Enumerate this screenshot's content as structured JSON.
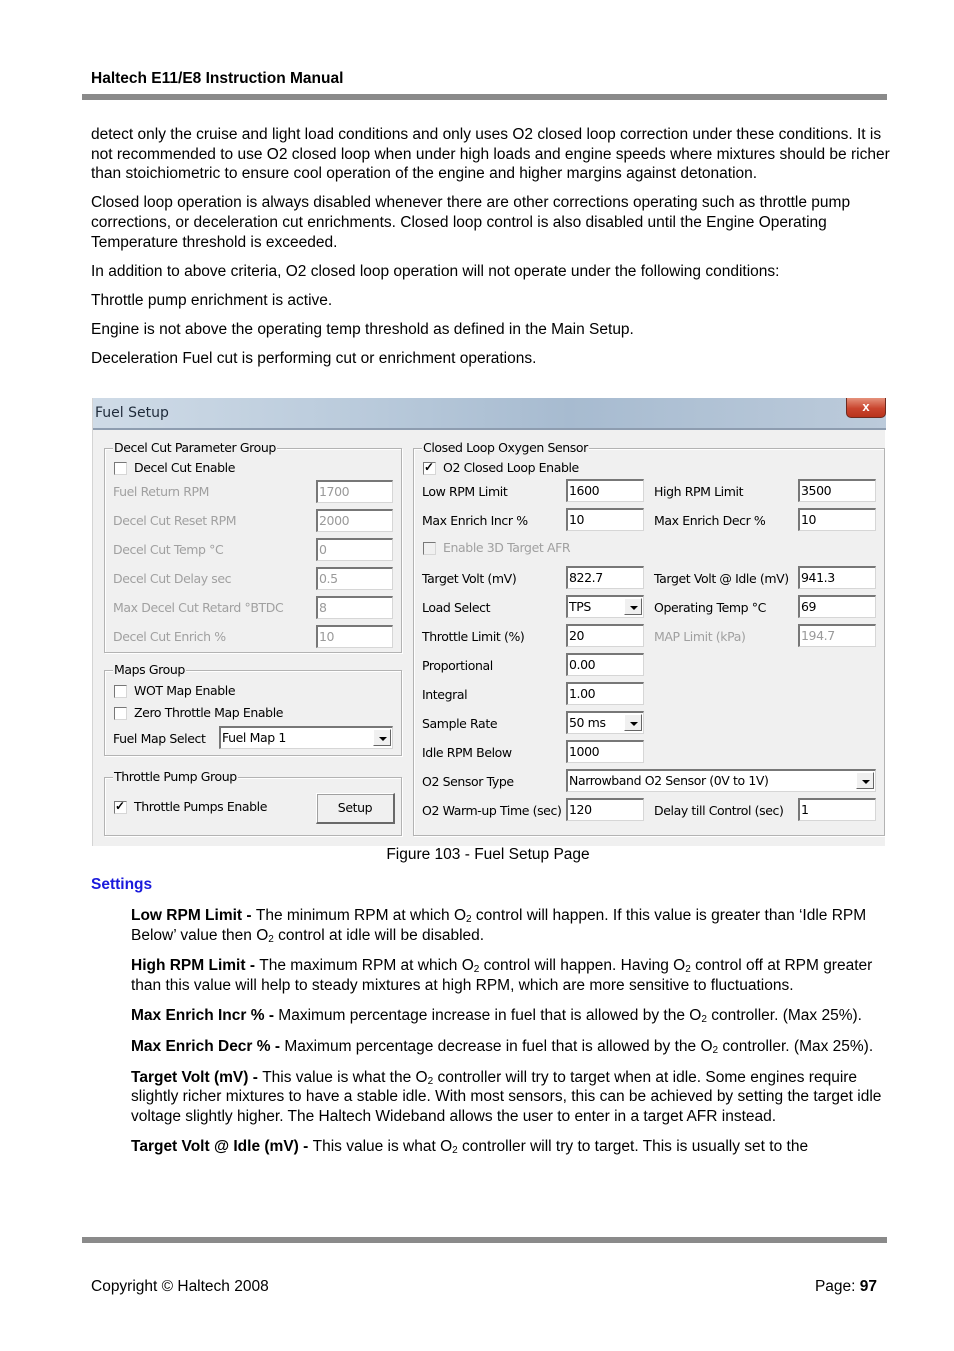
{
  "header": {
    "title": "Haltech E11/E8 Instruction Manual"
  },
  "intro_paragraphs": [
    "detect only the cruise and light load conditions and only uses O2 closed loop correction under these conditions. It is not recommended to use O2 closed loop when under high loads and engine speeds where mixtures should be richer than stoichiometric to ensure cool operation of the engine and higher margins against detonation.",
    "Closed loop operation is always disabled whenever there are other corrections operating such as throttle pump corrections, or deceleration cut enrichments. Closed loop control is also disabled until the Engine Operating Temperature threshold is exceeded.",
    "In addition to above criteria, O2 closed loop operation will not operate under the following conditions:",
    "Throttle pump enrichment is active.",
    "Engine is not above the operating temp threshold as defined in the Main Setup.",
    "Deceleration Fuel cut is performing cut or enrichment operations."
  ],
  "dialog": {
    "title": "Fuel Setup",
    "close_label": "x",
    "decel_group": {
      "title": "Decel Cut Parameter Group",
      "enable_label": "Decel Cut Enable",
      "enable_checked": false,
      "fields": [
        {
          "label": "Fuel Return RPM",
          "value": "1700"
        },
        {
          "label": "Decel Cut Reset RPM",
          "value": "2000"
        },
        {
          "label": "Decel Cut Temp °C",
          "value": "0"
        },
        {
          "label": "Decel Cut Delay sec",
          "value": "0.5"
        },
        {
          "label": "Max Decel Cut Retard °BTDC",
          "value": "8"
        },
        {
          "label": "Decel Cut Enrich %",
          "value": "10"
        }
      ]
    },
    "maps_group": {
      "title": "Maps Group",
      "wot_label": "WOT Map Enable",
      "wot_checked": false,
      "zero_throttle_label": "Zero Throttle Map Enable",
      "zero_throttle_checked": false,
      "fuel_map_label": "Fuel Map Select",
      "fuel_map_value": "Fuel Map 1"
    },
    "throttle_pump_group": {
      "title": "Throttle Pump Group",
      "enable_label": "Throttle Pumps Enable",
      "enable_checked": true,
      "setup_button": "Setup"
    },
    "o2_group": {
      "title": "Closed Loop Oxygen Sensor",
      "enable_label": "O2 Closed Loop Enable",
      "enable_checked": true,
      "low_rpm_label": "Low RPM Limit",
      "low_rpm_value": "1600",
      "high_rpm_label": "High RPM Limit",
      "high_rpm_value": "3500",
      "max_incr_label": "Max Enrich Incr %",
      "max_incr_value": "10",
      "max_decr_label": "Max Enrich Decr %",
      "max_decr_value": "10",
      "enable_3d_label": "Enable 3D Target AFR",
      "enable_3d_checked": false,
      "target_volt_label": "Target Volt (mV)",
      "target_volt_value": "822.7",
      "target_volt_idle_label": "Target Volt @ Idle (mV)",
      "target_volt_idle_value": "941.3",
      "load_select_label": "Load Select",
      "load_select_value": "TPS",
      "operating_temp_label": "Operating Temp °C",
      "operating_temp_value": "69",
      "throttle_limit_label": "Throttle Limit (%)",
      "throttle_limit_value": "20",
      "map_limit_label": "MAP Limit (kPa)",
      "map_limit_value": "194.7",
      "proportional_label": "Proportional",
      "proportional_value": "0.00",
      "integral_label": "Integral",
      "integral_value": "1.00",
      "sample_rate_label": "Sample Rate",
      "sample_rate_value": "50 ms",
      "idle_rpm_label": "Idle RPM Below",
      "idle_rpm_value": "1000",
      "sensor_type_label": "O2 Sensor Type",
      "sensor_type_value": "Narrowband O2 Sensor (0V to 1V)",
      "warmup_label": "O2 Warm-up Time (sec)",
      "warmup_value": "120",
      "delay_label": "Delay till Control (sec)",
      "delay_value": "1"
    }
  },
  "caption": "Figure 103 - Fuel Setup Page",
  "settings_heading": "Settings",
  "definitions": [
    {
      "term": "Low RPM Limit - ",
      "parts": [
        "The minimum RPM at which O",
        "2",
        " control will happen. If this value is greater than ‘Idle RPM Below’ value then O",
        "2",
        " control at idle will be disabled."
      ]
    },
    {
      "term": "High RPM Limit - ",
      "parts": [
        "The maximum RPM at which O",
        "2",
        " control will happen. Having O",
        "2",
        " control off at RPM greater than this value will help to steady mixtures at high RPM, which are more sensitive to fluctuations."
      ]
    },
    {
      "term": "Max Enrich Incr % - ",
      "parts": [
        "Maximum percentage increase in fuel that is allowed by the O",
        "2",
        " controller. (Max 25%)."
      ]
    },
    {
      "term": "Max Enrich Decr % - ",
      "parts": [
        "Maximum percentage decrease in fuel that is allowed by the O",
        "2",
        " controller. (Max 25%)."
      ]
    },
    {
      "term": "Target Volt (mV) - ",
      "parts": [
        "This value is what the O",
        "2",
        " controller will try to target when at idle. Some engines require slightly richer mixtures to have a stable idle. With most sensors, this can be achieved by setting the target idle voltage slightly higher. The Haltech Wideband allows the user to enter in a target AFR instead."
      ]
    },
    {
      "term": "Target Volt @ Idle (mV) - ",
      "parts": [
        "This value is what O",
        "2",
        " controller will try to target. This is usually set to the"
      ]
    }
  ],
  "footer": {
    "copyright": "Copyright © Haltech 2008",
    "page_label": "Page: ",
    "page_number": "97"
  }
}
